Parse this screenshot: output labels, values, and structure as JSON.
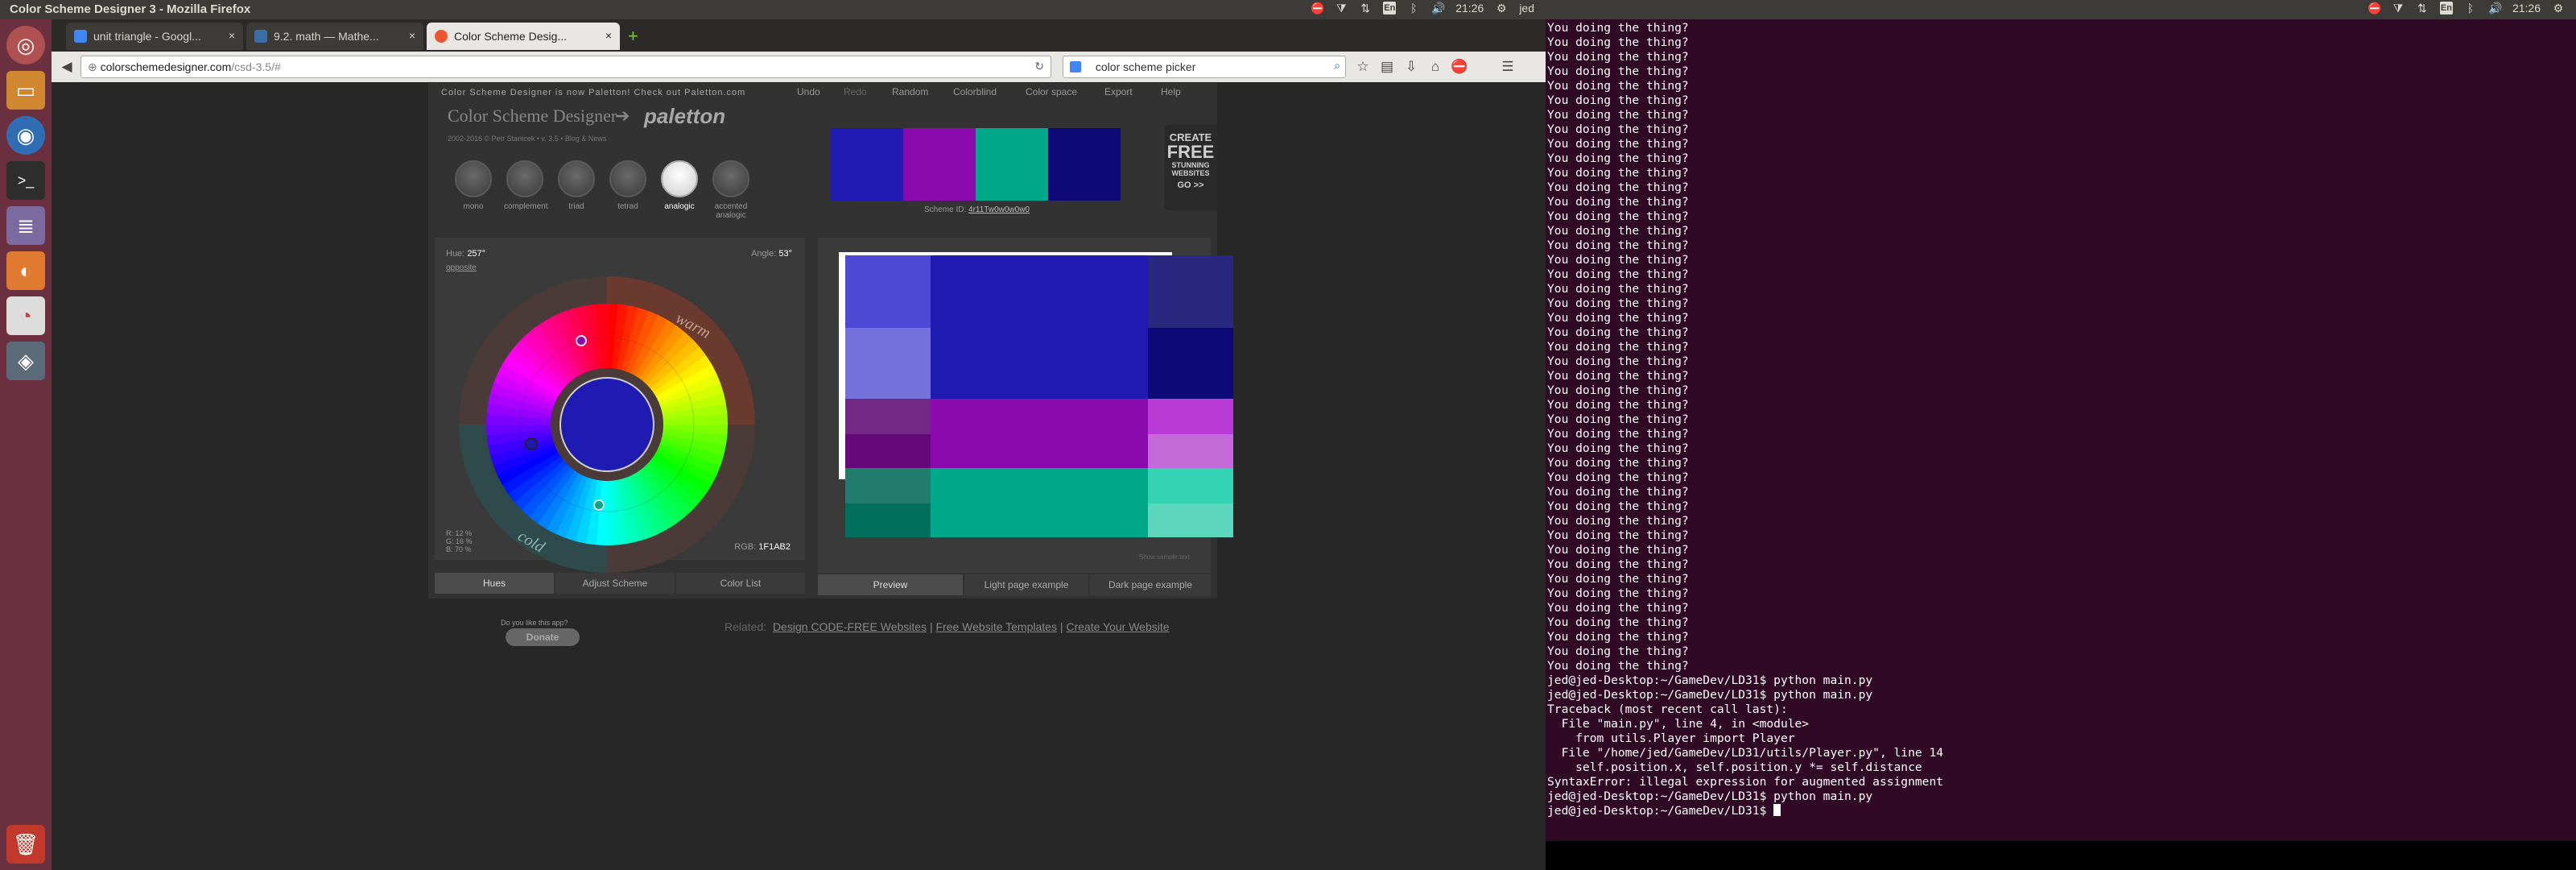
{
  "left_screen": {
    "window_title": "Color Scheme Designer 3 - Mozilla Firefox",
    "clock": "21:26",
    "user": "jed",
    "keyboard_layout": "En",
    "browser": {
      "tabs": [
        {
          "label": "unit triangle - Googl...",
          "icon": "google-icon",
          "active": false
        },
        {
          "label": "9.2. math — Mathe...",
          "icon": "python-docs-icon",
          "active": false
        },
        {
          "label": "Color Scheme Desig...",
          "icon": "globe-icon",
          "active": true
        }
      ],
      "new_tab_label": "+",
      "url_domain": "colorschemedesigner.com",
      "url_path": "/csd-3.5/#",
      "search_value": "color scheme picker"
    },
    "app": {
      "banner_notice": "Color Scheme Designer is now Paletton! Check out Paletton.com",
      "logo_text": "Color Scheme Designer",
      "logo_arrow": "➔",
      "paletton_logo": "paletton",
      "credits": "2002-2016 © Petr Stanicek • v. 3.5 • Blog & News",
      "menu": [
        "Undo",
        "Redo",
        "Random",
        "Colorblind",
        "Color space",
        "Export",
        "Help"
      ],
      "harmonies": [
        "mono",
        "complement",
        "triad",
        "tetrad",
        "analogic",
        "accented analogic"
      ],
      "selected_harmony": "analogic",
      "hue_label": "Hue:",
      "hue_value": "257°",
      "hue_link": "opposite",
      "angle_label": "Angle:",
      "angle_value": "53°",
      "wheel_warm": "warm",
      "wheel_cold": "cold",
      "rgb_pct": [
        "R: 12 %",
        "G: 16 %",
        "B: 70 %"
      ],
      "rgb_label": "RGB:",
      "rgb_value": "1F1AB2",
      "scheme_id_label": "Scheme ID:",
      "scheme_id_value": "4r11Tw0w0w0w0",
      "left_tabs": [
        "Hues",
        "Adjust Scheme",
        "Color List"
      ],
      "right_tabs": [
        "Preview",
        "Light page example",
        "Dark page example"
      ],
      "show_sample": "Show sample text",
      "ad_lines": [
        "CREATE",
        "FREE",
        "STUNNING",
        "WEBSITES",
        "GO >>"
      ],
      "donate_question": "Do you like this app?",
      "donate_button": "Donate",
      "related_label": "Related:",
      "related_links": [
        "Design CODE-FREE Websites",
        "Free Website Templates",
        "Create Your Website"
      ],
      "colors": {
        "primary": "#1f1ab2",
        "purple": "#8b0aad",
        "teal": "#00a88a",
        "navy": "#0d0a78",
        "primary_light": "#4d48d6",
        "primary_lighter": "#7672dc",
        "primary_dark": "#2a2780",
        "purple_light": "#b93ad6",
        "purple_lighter": "#c46ad8",
        "purple_dark": "#742886",
        "purple_darker": "#65097a",
        "teal_light": "#33d3b4",
        "teal_lighter": "#5cd6bd",
        "teal_dark": "#217c6b",
        "teal_darker": "#00705c"
      }
    }
  },
  "right_screen": {
    "clock": "21:26",
    "user": "jed",
    "keyboard_layout": "En",
    "terminal": {
      "repeated_line": "You doing the thing?",
      "repeated_count": 45,
      "tail_lines": [
        "jed@jed-Desktop:~/GameDev/LD31$ python main.py",
        "jed@jed-Desktop:~/GameDev/LD31$ python main.py",
        "Traceback (most recent call last):",
        "  File \"main.py\", line 4, in <module>",
        "    from utils.Player import Player",
        "  File \"/home/jed/GameDev/LD31/utils/Player.py\", line 14",
        "    self.position.x, self.position.y *= self.distance",
        "SyntaxError: illegal expression for augmented assignment",
        "jed@jed-Desktop:~/GameDev/LD31$ python main.py",
        "jed@jed-Desktop:~/GameDev/LD31$ "
      ]
    }
  }
}
